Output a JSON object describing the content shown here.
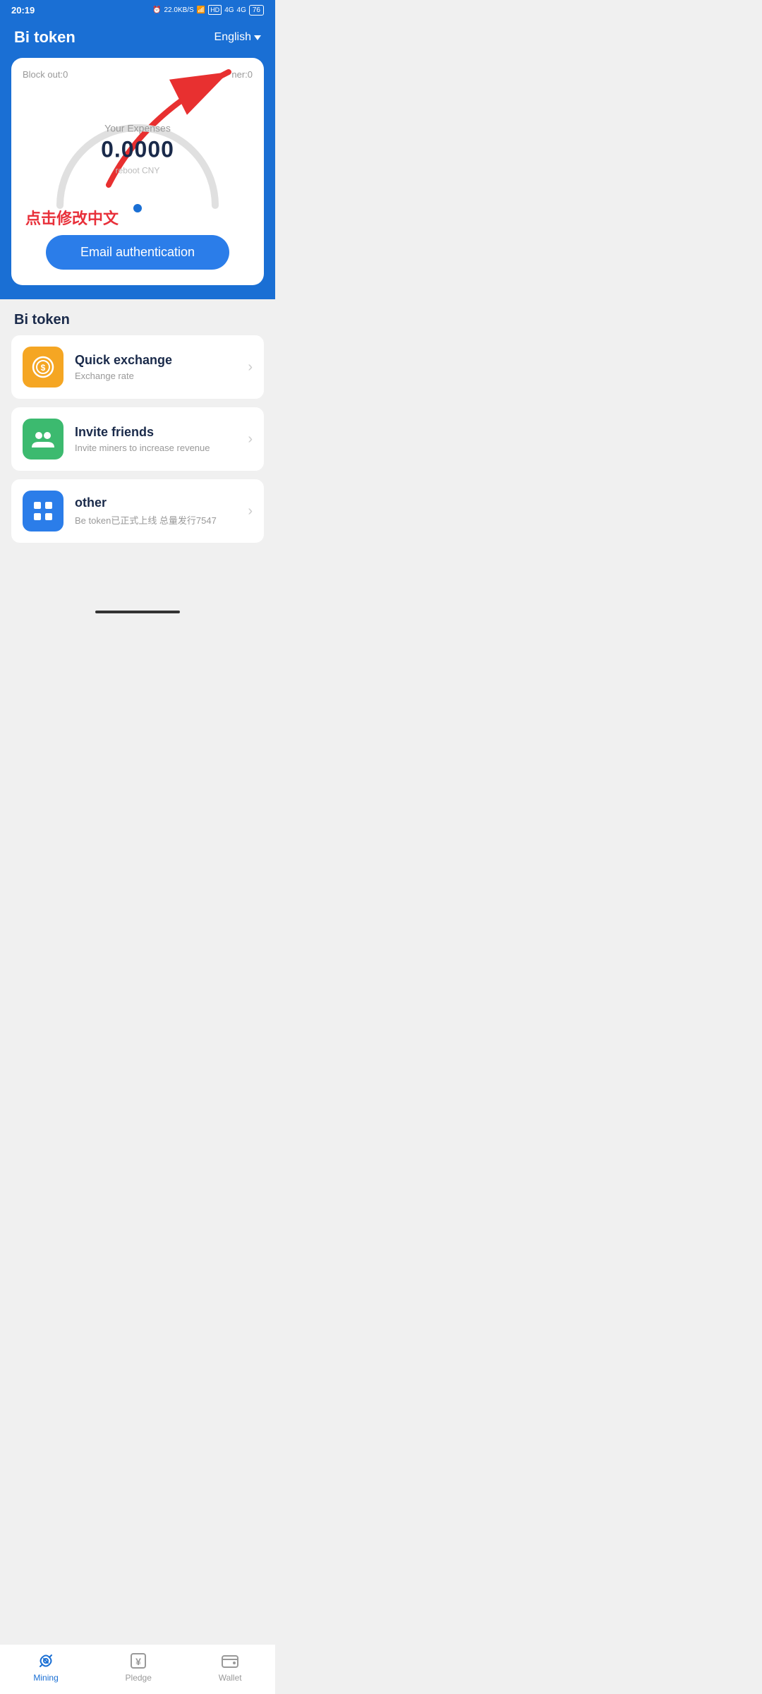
{
  "statusBar": {
    "time": "20:19",
    "icons": "⏰ 22.0 KB/S ⊙ HD 4G 4G 76"
  },
  "header": {
    "title": "Bi token",
    "language": "English"
  },
  "card": {
    "blockOutLabel": "Block out:",
    "blockOutValue": "0",
    "timerLabel": "ner:0",
    "expensesLabel": "Your Expenses",
    "expensesValue": "0.0000",
    "expensesSubtitle": "reboot CNY",
    "chineseAnnotation": "点击修改中文",
    "authButton": "Email authentication"
  },
  "section": {
    "title": "Bi token"
  },
  "menuItems": [
    {
      "id": "quick-exchange",
      "title": "Quick exchange",
      "subtitle": "Exchange rate",
      "iconColor": "orange",
      "iconType": "coin"
    },
    {
      "id": "invite-friends",
      "title": "Invite friends",
      "subtitle": "Invite miners to increase revenue",
      "iconColor": "green",
      "iconType": "friends"
    },
    {
      "id": "other",
      "title": "other",
      "subtitle": "Be token已正式上线 总量发行7547",
      "iconColor": "blue",
      "iconType": "grid"
    }
  ],
  "bottomNav": [
    {
      "id": "mining",
      "label": "Mining",
      "active": true,
      "icon": "link"
    },
    {
      "id": "pledge",
      "label": "Pledge",
      "active": false,
      "icon": "yen"
    },
    {
      "id": "wallet",
      "label": "Wallet",
      "active": false,
      "icon": "wallet"
    }
  ]
}
